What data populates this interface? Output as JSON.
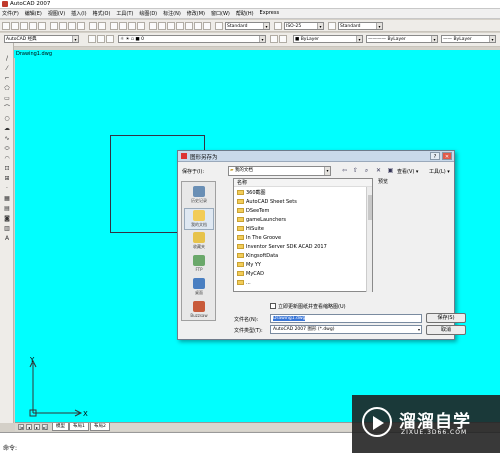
{
  "app": {
    "title": "AutoCAD 2007"
  },
  "menu": [
    "文件(F)",
    "编辑(E)",
    "视图(V)",
    "插入(I)",
    "格式(O)",
    "工具(T)",
    "绘图(D)",
    "标注(N)",
    "修改(M)",
    "窗口(W)",
    "帮助(H)",
    "Express"
  ],
  "toolbar": {
    "text_style": "Standard",
    "dim_style": "ISO-25",
    "table_style": "Standard",
    "workspace": "AutoCAD 经典",
    "layer": "0",
    "color": "ByLayer",
    "linetype": "ByLayer",
    "lineweight": "ByLayer",
    "plot_style": "随颜色"
  },
  "drawing": {
    "tab_title": "Drawing1.dwg"
  },
  "ucs": {
    "x_label": "X",
    "y_label": "Y"
  },
  "layout_tabs": [
    "模型",
    "布局1",
    "布局2"
  ],
  "command": {
    "prompt": "命令:"
  },
  "dialog": {
    "title": "图形另存为",
    "save_in_label": "保存于(I):",
    "save_in_value": "我的文档",
    "views_label": "查看(V)",
    "tools_label": "工具(L)",
    "places": [
      "历史记录",
      "我的文档",
      "收藏夹",
      "FTP",
      "桌面",
      "Buzzsaw"
    ],
    "list_header": "名称",
    "files": [
      "360截图",
      "AutoCAD Sheet Sets",
      "DSeeTem",
      "gameLaunchers",
      "HiSuite",
      "In The Groove",
      "Inventor Server SDK ACAD 2017",
      "KingsoftData",
      "My YY",
      "MyCAD",
      "..."
    ],
    "preview_label": "预览",
    "checkbox_label": "立即更新图纸并查看缩略图(U)",
    "filename_label": "文件名(N):",
    "filename_value": "Drawing1.dwg",
    "filetype_label": "文件类型(T):",
    "filetype_value": "AutoCAD 2007 图形 (*.dwg)",
    "save_button": "保存(S)",
    "cancel_button": "取消"
  },
  "watermark": {
    "brand": "溜溜自学",
    "url": "ZIXUE.3D66.COM"
  },
  "colors": {
    "canvas": "#00ffff",
    "dialog": "#f0f0f0",
    "titlebar": "#c9d9ea"
  }
}
